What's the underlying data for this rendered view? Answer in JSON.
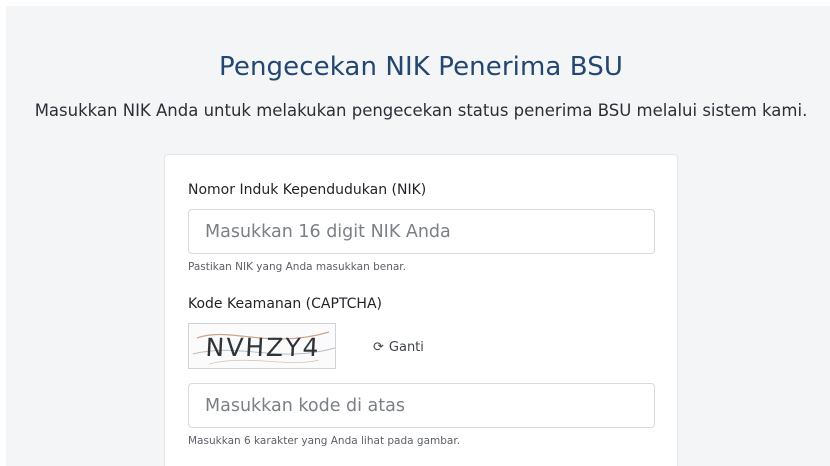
{
  "header": {
    "title": "Pengecekan NIK Penerima BSU",
    "subtitle": "Masukkan NIK Anda untuk melakukan pengecekan status penerima BSU melalui sistem kami."
  },
  "form": {
    "nik": {
      "label": "Nomor Induk Kependudukan (NIK)",
      "placeholder": "Masukkan 16 digit NIK Anda",
      "value": "",
      "hint": "Pastikan NIK yang Anda masukkan benar."
    },
    "captcha": {
      "label": "Kode Keamanan (CAPTCHA)",
      "code": "NVHZY4",
      "refresh_icon": "refresh-icon",
      "refresh_label": "Ganti",
      "placeholder": "Masukkan kode di atas",
      "value": "",
      "hint": "Masukkan 6 karakter yang Anda lihat pada gambar."
    }
  },
  "colors": {
    "title": "#23476f",
    "background": "#f4f5f7",
    "card": "#ffffff"
  }
}
